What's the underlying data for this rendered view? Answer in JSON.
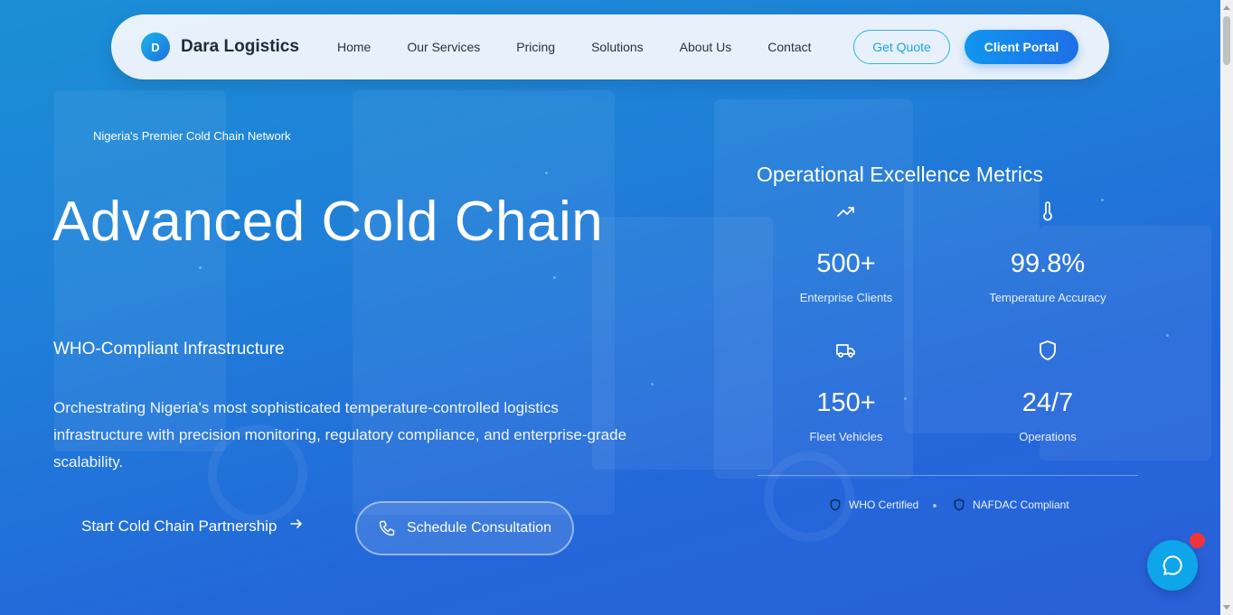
{
  "nav": {
    "brand_initial": "D",
    "brand_name": "Dara Logistics",
    "links": [
      "Home",
      "Our Services",
      "Pricing",
      "Solutions",
      "About Us",
      "Contact"
    ],
    "get_quote": "Get Quote",
    "client_portal": "Client Portal"
  },
  "hero": {
    "tagline": "Nigeria's Premier Cold Chain Network",
    "title": "Advanced Cold Chain",
    "subtitle": "WHO-Compliant Infrastructure",
    "description": "Orchestrating Nigeria's most sophisticated temperature-controlled logistics infrastructure with precision monitoring, regulatory compliance, and enterprise-grade scalability.",
    "cta_primary": "Start Cold Chain Partnership",
    "cta_secondary": "Schedule Consultation"
  },
  "metrics": {
    "title": "Operational Excellence Metrics",
    "items": [
      {
        "icon": "trending-up-icon",
        "value": "500+",
        "label": "Enterprise Clients"
      },
      {
        "icon": "thermometer-icon",
        "value": "99.8%",
        "label": "Temperature Accuracy"
      },
      {
        "icon": "truck-icon",
        "value": "150+",
        "label": "Fleet Vehicles"
      },
      {
        "icon": "shield-icon",
        "value": "24/7",
        "label": "Operations"
      }
    ],
    "certifications": [
      "WHO Certified",
      "NAFDAC Compliant"
    ]
  },
  "colors": {
    "accent": "#1096f0",
    "chat": "#0ea5ea",
    "notification": "#f0343c"
  }
}
